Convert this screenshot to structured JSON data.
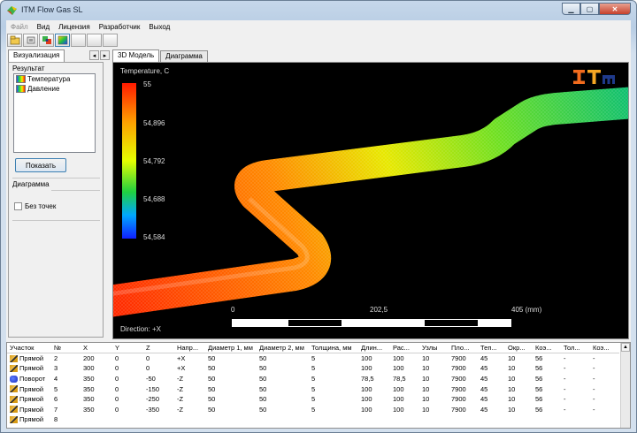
{
  "window": {
    "title": "ITM Flow Gas SL"
  },
  "menu": [
    {
      "label": "Файл",
      "disabled": true
    },
    {
      "label": "Вид",
      "disabled": false
    },
    {
      "label": "Лицензия",
      "disabled": false
    },
    {
      "label": "Разработчик",
      "disabled": false
    },
    {
      "label": "Выход",
      "disabled": false
    }
  ],
  "left_panel": {
    "tab": "Визуализация",
    "result_group": "Результат",
    "results": [
      "Температура",
      "Давление"
    ],
    "show_button": "Показать",
    "diagram_group": "Диаграмма",
    "no_points_label": "Без точек"
  },
  "main_tabs": [
    "3D Модель",
    "Диаграмма"
  ],
  "view": {
    "legend_title": "Temperature, C",
    "legend_ticks": [
      "55",
      "54,896",
      "54,792",
      "54,688",
      "54,584"
    ],
    "scale_labels": [
      "0",
      "202,5",
      "405 (mm)"
    ],
    "direction": "Direction: +X",
    "logo": "ITM"
  },
  "table": {
    "headers": [
      "Участок",
      "№",
      "X",
      "Y",
      "Z",
      "Напр...",
      "Диаметр 1, мм",
      "Диаметр 2, мм",
      "Толщина, мм",
      "Длин...",
      "Рас...",
      "Узлы",
      "Пло...",
      "Теп...",
      "Окр...",
      "Коэ...",
      "Тол...",
      "Коэ..."
    ],
    "rows": [
      {
        "icon": "straight",
        "cells": [
          "Прямой",
          "2",
          "200",
          "0",
          "0",
          "+X",
          "50",
          "50",
          "5",
          "100",
          "100",
          "10",
          "7900",
          "45",
          "10",
          "56",
          "-",
          "-"
        ]
      },
      {
        "icon": "straight",
        "cells": [
          "Прямой",
          "3",
          "300",
          "0",
          "0",
          "+X",
          "50",
          "50",
          "5",
          "100",
          "100",
          "10",
          "7900",
          "45",
          "10",
          "56",
          "-",
          "-"
        ]
      },
      {
        "icon": "bend",
        "cells": [
          "Поворот",
          "4",
          "350",
          "0",
          "-50",
          "-Z",
          "50",
          "50",
          "5",
          "78,5",
          "78,5",
          "10",
          "7900",
          "45",
          "10",
          "56",
          "-",
          "-"
        ]
      },
      {
        "icon": "straight",
        "cells": [
          "Прямой",
          "5",
          "350",
          "0",
          "-150",
          "-Z",
          "50",
          "50",
          "5",
          "100",
          "100",
          "10",
          "7900",
          "45",
          "10",
          "56",
          "-",
          "-"
        ]
      },
      {
        "icon": "straight",
        "cells": [
          "Прямой",
          "6",
          "350",
          "0",
          "-250",
          "-Z",
          "50",
          "50",
          "5",
          "100",
          "100",
          "10",
          "7900",
          "45",
          "10",
          "56",
          "-",
          "-"
        ]
      },
      {
        "icon": "straight",
        "cells": [
          "Прямой",
          "7",
          "350",
          "0",
          "-350",
          "-Z",
          "50",
          "50",
          "5",
          "100",
          "100",
          "10",
          "7900",
          "45",
          "10",
          "56",
          "-",
          "-"
        ]
      },
      {
        "icon": "straight",
        "cells": [
          "Прямой",
          "8",
          "",
          "",
          "",
          "",
          "",
          "",
          "",
          "",
          "",
          "",
          "",
          "",
          "",
          "",
          "",
          ""
        ]
      }
    ]
  },
  "colors": {
    "logo_orange": "#f26b1d",
    "logo_blue": "#1f3a8a",
    "pipe_hot": "#ff2a00",
    "pipe_cool": "#20c040"
  }
}
